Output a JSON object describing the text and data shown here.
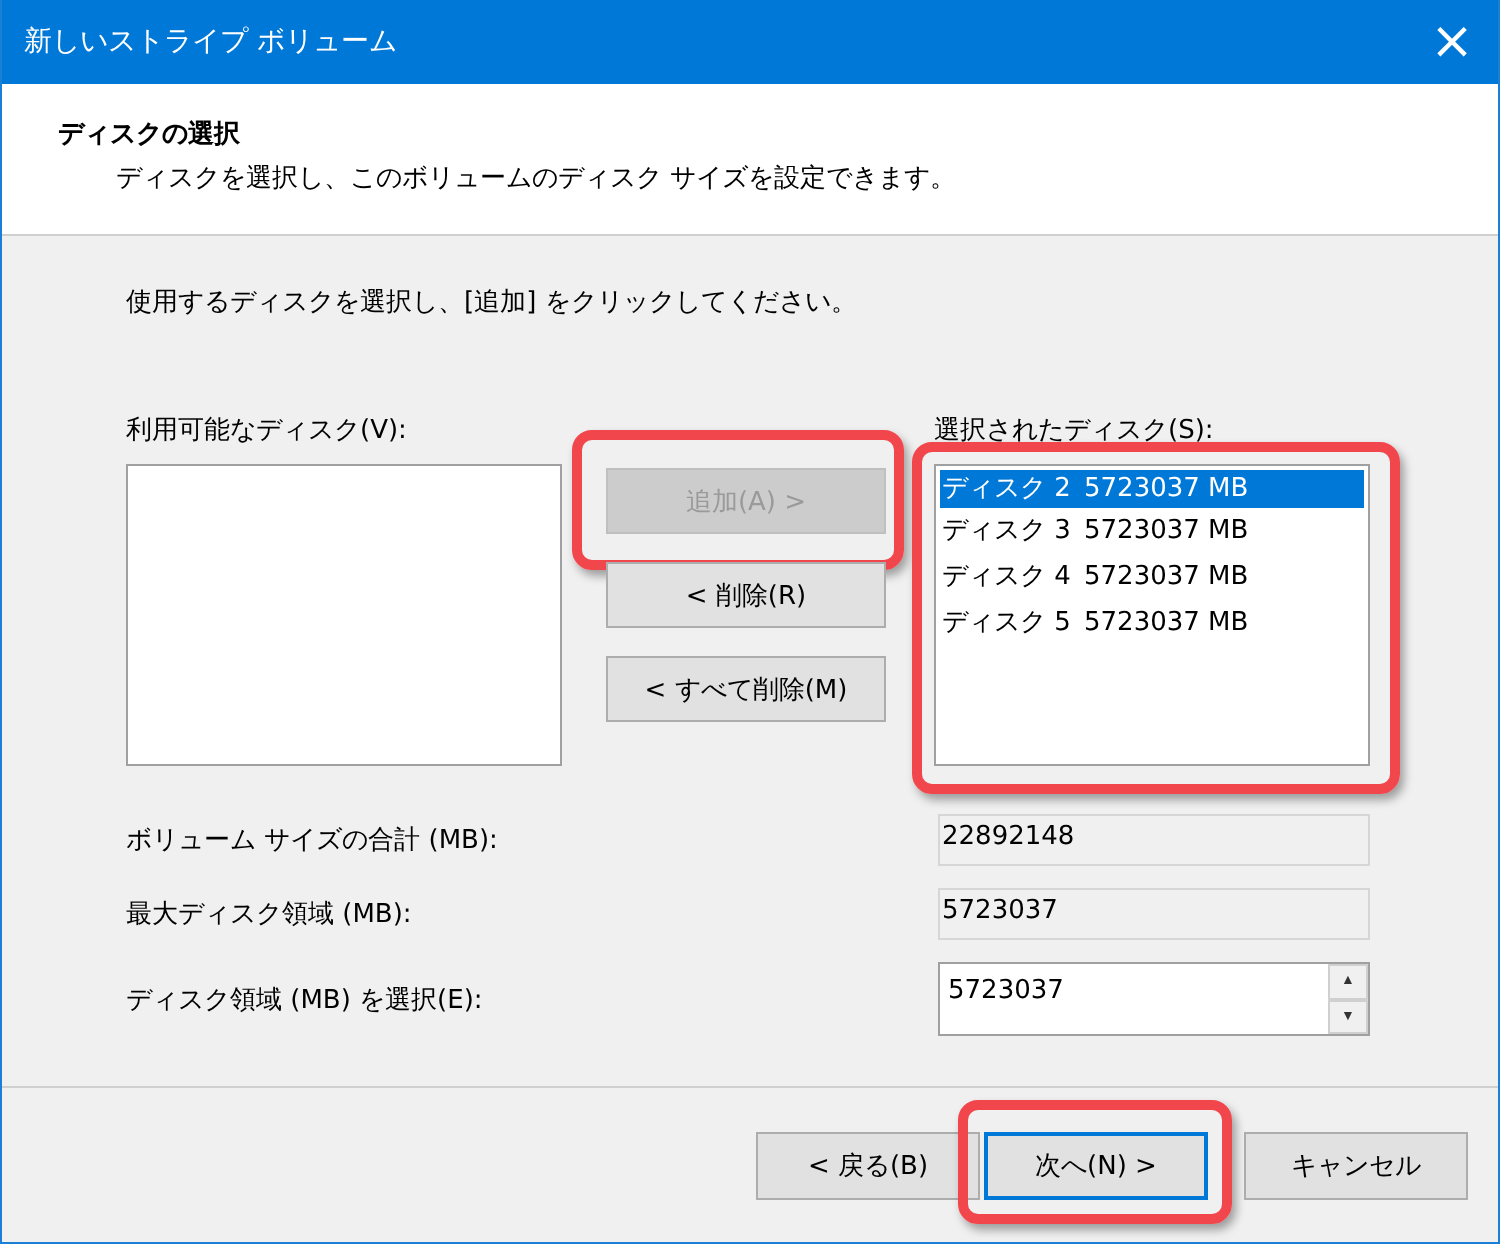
{
  "window": {
    "title": "新しいストライプ ボリューム",
    "close": "×"
  },
  "header": {
    "title": "ディスクの選択",
    "subtitle": "ディスクを選択し、このボリュームのディスク サイズを設定できます。"
  },
  "instruction": "使用するディスクを選択し、[追加] をクリックしてください。",
  "available": {
    "label": "利用可能なディスク(V):"
  },
  "actions": [
    {
      "label": "追加(A) >",
      "disabled": true,
      "highlighted": true
    },
    {
      "label": "< 削除(R)",
      "disabled": false,
      "highlighted": false
    },
    {
      "label": "< すべて削除(M)",
      "disabled": false,
      "highlighted": false
    }
  ],
  "selected_disks": {
    "label": "選択されたディスク(S):",
    "highlighted": true,
    "items": [
      {
        "name": "ディスク 2",
        "size": "5723037 MB",
        "selected": true
      },
      {
        "name": "ディスク 3",
        "size": "5723037 MB",
        "selected": false
      },
      {
        "name": "ディスク 4",
        "size": "5723037 MB",
        "selected": false
      },
      {
        "name": "ディスク 5",
        "size": "5723037 MB",
        "selected": false
      }
    ]
  },
  "fields": [
    {
      "label": "ボリューム サイズの合計 (MB):",
      "value": "22892148",
      "kind": "readonly"
    },
    {
      "label": "最大ディスク領域 (MB):",
      "value": "5723037",
      "kind": "readonly"
    },
    {
      "label": "ディスク領域 (MB) を選択(E):",
      "value": "5723037",
      "kind": "spin",
      "up": "▲",
      "down": "▼"
    }
  ],
  "buttons": [
    {
      "label": "< 戻る(B)",
      "focused": false,
      "highlighted": false
    },
    {
      "label": "次へ(N) >",
      "focused": true,
      "highlighted": true
    },
    {
      "label": "キャンセル",
      "focused": false,
      "highlighted": false
    }
  ]
}
